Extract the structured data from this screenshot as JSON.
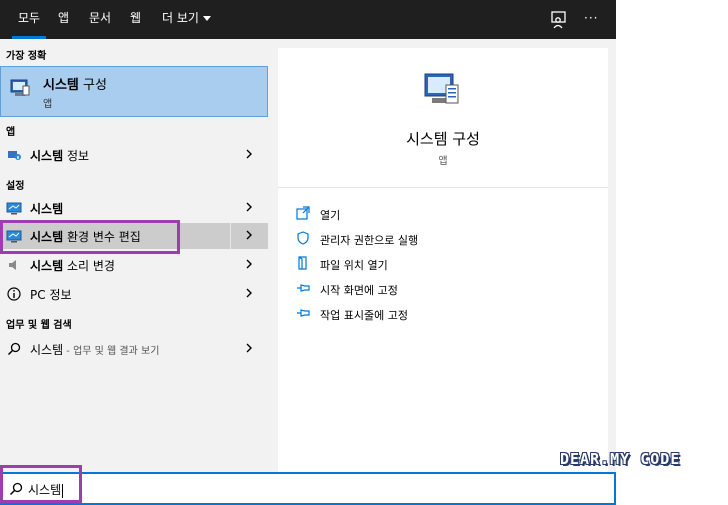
{
  "tabs": [
    {
      "label": "모두"
    },
    {
      "label": "앱"
    },
    {
      "label": "문서"
    },
    {
      "label": "웹"
    },
    {
      "label": "더 보기"
    }
  ],
  "toolbar": {
    "feedback_icon": "feedback-icon",
    "more_label": "···"
  },
  "sections": {
    "best_match": "가장 정확",
    "apps": "앱",
    "settings": "설정",
    "web": "업무 및 웹 검색"
  },
  "best_match": {
    "title_bold": "시스템",
    "title_rest": " 구성",
    "subtitle": "앱"
  },
  "app_results": [
    {
      "bold": "시스템",
      "rest": " 정보"
    }
  ],
  "settings_results": [
    {
      "bold": "시스템",
      "rest": ""
    },
    {
      "bold": "시스템",
      "rest": " 환경 변수 편집"
    },
    {
      "bold": "시스템",
      "rest": " 소리 변경"
    },
    {
      "bold": "PC",
      "rest": " 정보"
    }
  ],
  "web_result": {
    "term": "시스템",
    "suffix": " - 업무 및 웹 결과 보기"
  },
  "preview": {
    "title": "시스템 구성",
    "subtitle": "앱",
    "actions": [
      {
        "label": "열기",
        "icon": "open-icon"
      },
      {
        "label": "관리자 권한으로 실행",
        "icon": "shield-icon"
      },
      {
        "label": "파일 위치 열기",
        "icon": "file-location-icon"
      },
      {
        "label": "시작 화면에 고정",
        "icon": "pin-icon"
      },
      {
        "label": "작업 표시줄에 고정",
        "icon": "pin-icon"
      }
    ]
  },
  "search": {
    "query": "시스템"
  },
  "watermark": "DEAR.MY CODE",
  "colors": {
    "accent": "#0078d7",
    "selection": "#a9cdee",
    "annotation": "#9b3fae"
  }
}
